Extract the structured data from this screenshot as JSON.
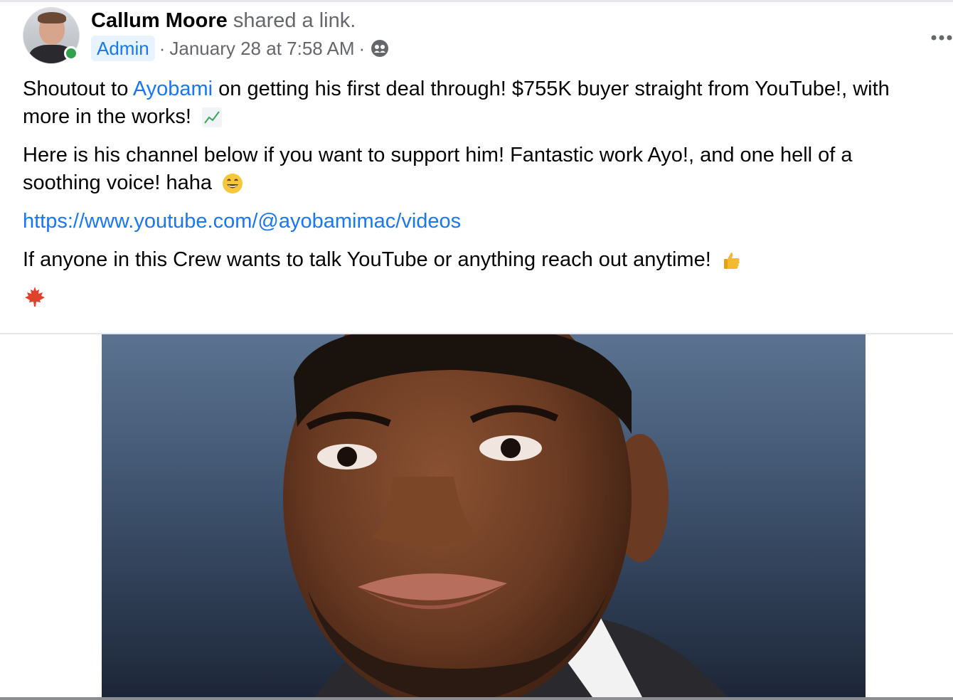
{
  "post": {
    "author": "Callum Moore",
    "action": "shared a link.",
    "badge": "Admin",
    "timestamp": "January 28 at 7:58 AM",
    "separator": "·",
    "audience_icon": "group-audience-icon",
    "more_icon": "more-options-icon",
    "paragraph1_prefix": "Shoutout to ",
    "paragraph1_mention": "Ayobami",
    "paragraph1_suffix": " on getting his first deal through! $755K buyer straight from YouTube!, with more in the works! ",
    "paragraph1_emoji": "chart-increasing-emoji",
    "paragraph2": "Here is his channel below if you want to support him! Fantastic work Ayo!, and one hell of a soothing voice! haha ",
    "paragraph2_emoji": "grinning-face-emoji",
    "link": "https://www.youtube.com/@ayobamimac/videos",
    "paragraph3": "If anyone in this Crew wants to talk YouTube or anything reach out anytime! ",
    "paragraph3_emoji": "thumbs-up-emoji",
    "closing_emoji": "maple-leaf-emoji",
    "link_preview_image": "portrait-photo"
  },
  "colors": {
    "accent": "#1877f2",
    "secondary_text": "#65676b",
    "online": "#31a24c",
    "badge_bg": "#e7f3ff"
  }
}
